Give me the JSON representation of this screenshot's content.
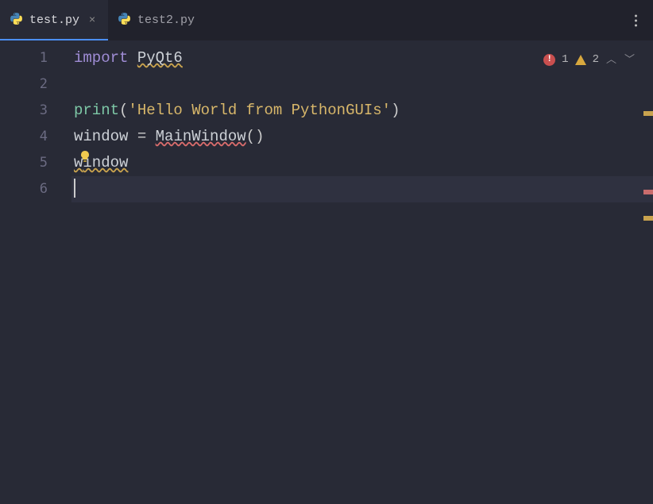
{
  "tabs": [
    {
      "label": "test.py",
      "active": true
    },
    {
      "label": "test2.py",
      "active": false
    }
  ],
  "gutter": [
    "1",
    "2",
    "3",
    "4",
    "5",
    "6"
  ],
  "status": {
    "errors": "1",
    "warnings": "2"
  },
  "code": {
    "l1_kw": "import",
    "l1_mod": "PyQt6",
    "l3_fn": "print",
    "l3_lp": "(",
    "l3_str": "'Hello World from PythonGUIs'",
    "l3_rp": ")",
    "l4_var": "window",
    "l4_eq": " = ",
    "l4_cls": "MainWindow",
    "l4_pp": "()",
    "l5_w": "w",
    "l5_rest": "indow"
  },
  "icons": {
    "python": "python-icon"
  }
}
